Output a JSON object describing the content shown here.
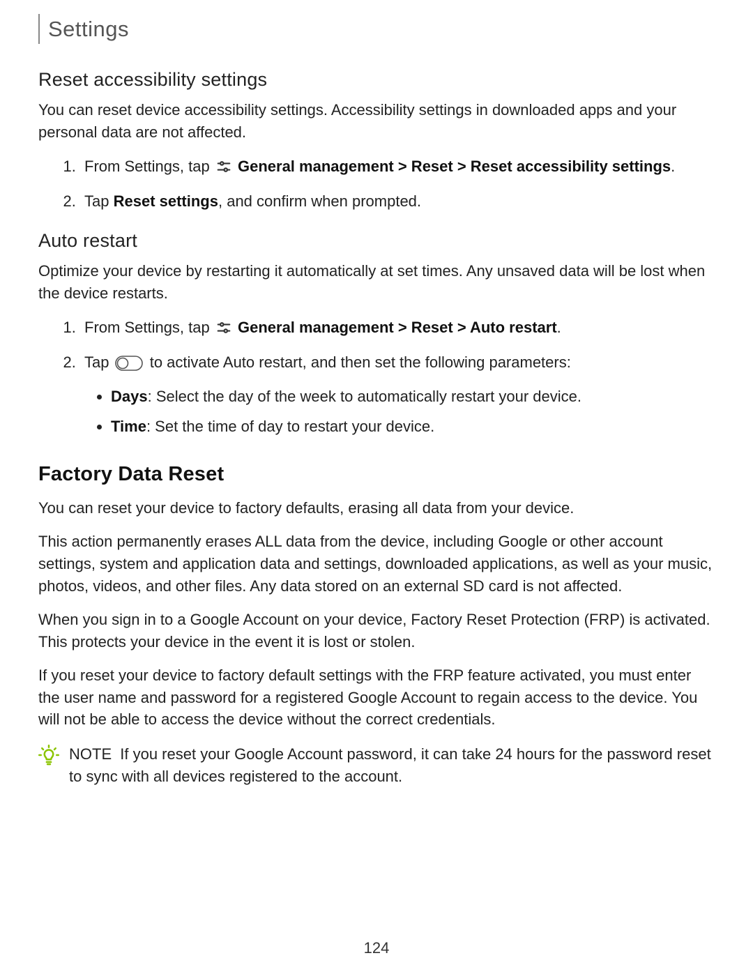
{
  "doc_title": "Settings",
  "page_number": "124",
  "section1": {
    "heading": "Reset accessibility settings",
    "intro": "You can reset device accessibility settings. Accessibility settings in downloaded apps and your personal data are not affected.",
    "step1_prefix": "From Settings, tap ",
    "step1_bold": "General management > Reset > Reset accessibility settings",
    "step1_suffix": ".",
    "step2_prefix": "Tap ",
    "step2_bold": "Reset settings",
    "step2_suffix": ", and confirm when prompted."
  },
  "section2": {
    "heading": "Auto restart",
    "intro": "Optimize your device by restarting it automatically at set times. Any unsaved data will be lost when the device restarts.",
    "step1_prefix": "From Settings, tap ",
    "step1_bold": "General management > Reset > Auto restart",
    "step1_suffix": ".",
    "step2_prefix": "Tap ",
    "step2_suffix": " to activate Auto restart, and then set the following parameters:",
    "bulletA_bold": "Days",
    "bulletA_text": ": Select the day of the week to automatically restart your device.",
    "bulletB_bold": "Time",
    "bulletB_text": ": Set the time of day to restart your device."
  },
  "section3": {
    "heading": "Factory Data Reset",
    "p1": "You can reset your device to factory defaults, erasing all data from your device.",
    "p2": "This action permanently erases ALL data from the device, including Google or other account settings, system and application data and settings, downloaded applications, as well as your music, photos, videos, and other files. Any data stored on an external SD card is not affected.",
    "p3": "When you sign in to a Google Account on your device, Factory Reset Protection (FRP) is activated. This protects your device in the event it is lost or stolen.",
    "p4": "If you reset your device to factory default settings with the FRP feature activated, you must enter the user name and password for a registered Google Account to regain access to the device. You will not be able to access the device without the correct credentials.",
    "note_label": "NOTE",
    "note_text": "If you reset your Google Account password, it can take 24 hours for the password reset to sync with all devices registered to the account."
  }
}
